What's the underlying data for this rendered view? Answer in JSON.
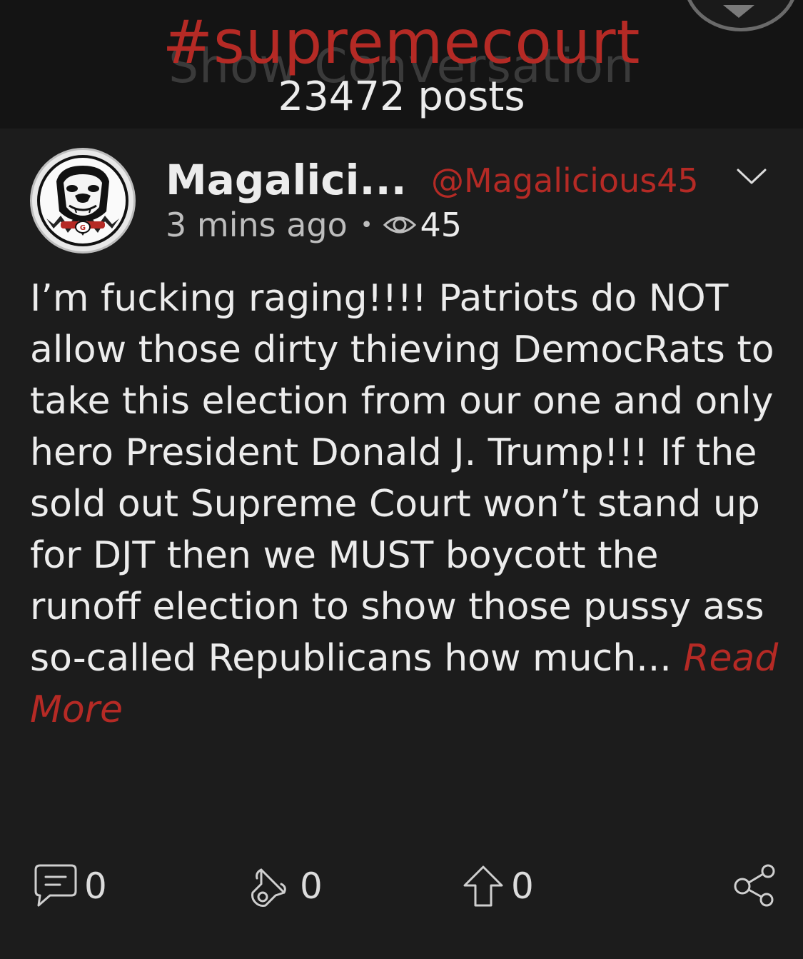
{
  "header": {
    "hashtag": "#supremecourt",
    "ghost_text": "Show Conversation",
    "post_count": "23472 posts"
  },
  "post": {
    "author_name": "Magalici...",
    "author_handle": "@Magalicious45",
    "time_ago": "3 mins ago",
    "separator": "•",
    "views": "45",
    "body_text": "I’m fucking raging!!!! Patriots do NOT allow those dirty thieving DemocRats to take this election from our one and only hero President Donald J. Trump!!! If the sold out Supreme Court won’t stand up for DJT then we MUST boycott the runoff election to show those pussy ass so-called Republicans how much...",
    "read_more": "Read More",
    "actions": {
      "comments": "0",
      "echoes": "0",
      "upvotes": "0"
    }
  },
  "icons": {
    "comment": "comment-icon",
    "megaphone": "megaphone-icon",
    "upvote": "upvote-arrow-icon",
    "share": "share-icon",
    "eye": "eye-icon",
    "chevron": "chevron-down-icon"
  },
  "colors": {
    "accent": "#b52a25",
    "background": "#1c1c1c",
    "header_background": "#141414",
    "text": "#ececec"
  }
}
